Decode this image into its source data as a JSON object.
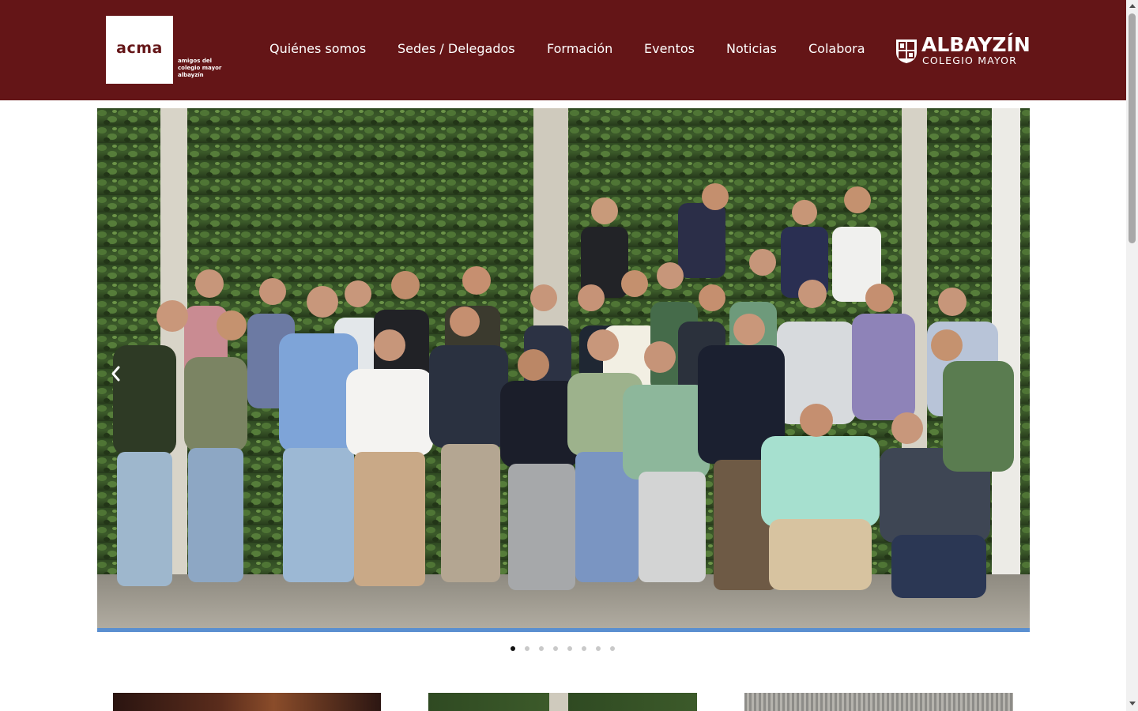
{
  "header": {
    "logo_text": "acma",
    "logo_tagline": [
      "amigos del",
      "colegio mayor",
      "albayzín"
    ],
    "nav": [
      {
        "label": "Quiénes somos"
      },
      {
        "label": "Sedes / Delegados"
      },
      {
        "label": "Formación"
      },
      {
        "label": "Eventos"
      },
      {
        "label": "Noticias"
      },
      {
        "label": "Colabora"
      }
    ],
    "brand_title": "ALBAYZÍN",
    "brand_subtitle": "COLEGIO MAYOR",
    "brand_icon": "crest-icon"
  },
  "slider": {
    "prev_icon": "chevron-left-icon",
    "slide_count": 8,
    "active_index": 0
  },
  "colors": {
    "header_bg": "#641517",
    "dot_active": "#111111",
    "dot_inactive": "#c9c9c9"
  }
}
